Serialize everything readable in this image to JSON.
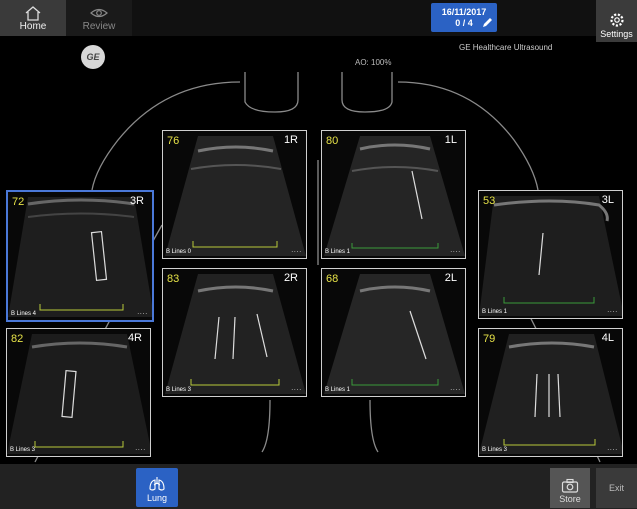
{
  "nav": {
    "home_label": "Home",
    "review_label": "Review"
  },
  "exam": {
    "date": "16/11/2017",
    "count": "0 / 4"
  },
  "settings_label": "Settings",
  "brand": "GE Healthcare Ultrasound",
  "ao": "AO: 100%",
  "logo_text": "GE",
  "tiles": [
    {
      "score": "72",
      "zone": "3R",
      "blines": "B Lines 4"
    },
    {
      "score": "76",
      "zone": "1R",
      "blines": "B Lines 0"
    },
    {
      "score": "80",
      "zone": "1L",
      "blines": "B Lines 1"
    },
    {
      "score": "53",
      "zone": "3L",
      "blines": "B Lines 1"
    },
    {
      "score": "83",
      "zone": "2R",
      "blines": "B Lines 3"
    },
    {
      "score": "68",
      "zone": "2L",
      "blines": "B Lines 1"
    },
    {
      "score": "82",
      "zone": "4R",
      "blines": "B Lines 3"
    },
    {
      "score": "79",
      "zone": "4L",
      "blines": "B Lines 3"
    }
  ],
  "dots": "....",
  "bottom": {
    "lung_label": "Lung",
    "store_label": "Store",
    "exit_label": "Exit"
  },
  "colors": {
    "accent": "#2b62c4",
    "score": "#e7e348",
    "selected_border": "#4a78d8"
  }
}
